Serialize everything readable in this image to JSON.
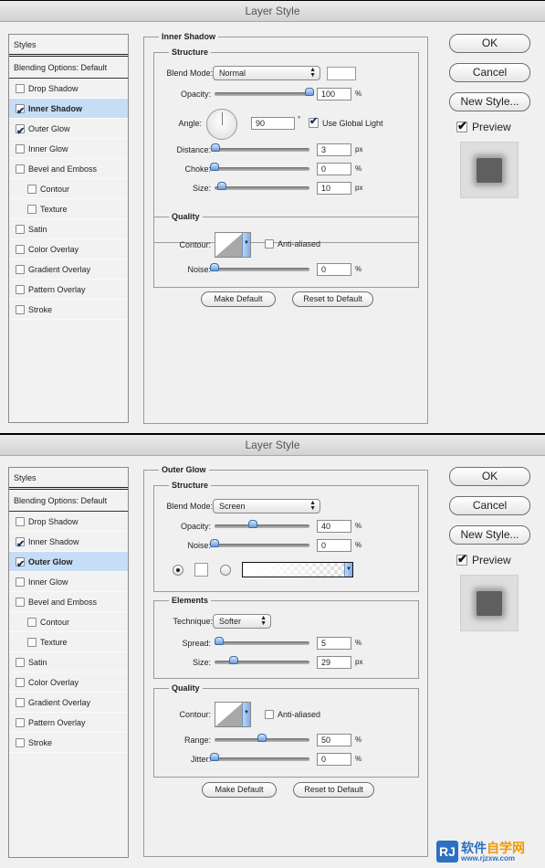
{
  "dialogs": [
    {
      "title": "Layer Style",
      "styles_header": "Styles",
      "blending_options": "Blending Options: Default",
      "items": [
        {
          "label": "Drop Shadow",
          "checked": false,
          "selected": false,
          "sub": false
        },
        {
          "label": "Inner Shadow",
          "checked": true,
          "selected": true,
          "sub": false
        },
        {
          "label": "Outer Glow",
          "checked": true,
          "selected": false,
          "sub": false
        },
        {
          "label": "Inner Glow",
          "checked": false,
          "selected": false,
          "sub": false
        },
        {
          "label": "Bevel and Emboss",
          "checked": false,
          "selected": false,
          "sub": false
        },
        {
          "label": "Contour",
          "checked": false,
          "selected": false,
          "sub": true
        },
        {
          "label": "Texture",
          "checked": false,
          "selected": false,
          "sub": true
        },
        {
          "label": "Satin",
          "checked": false,
          "selected": false,
          "sub": false
        },
        {
          "label": "Color Overlay",
          "checked": false,
          "selected": false,
          "sub": false
        },
        {
          "label": "Gradient Overlay",
          "checked": false,
          "selected": false,
          "sub": false
        },
        {
          "label": "Pattern Overlay",
          "checked": false,
          "selected": false,
          "sub": false
        },
        {
          "label": "Stroke",
          "checked": false,
          "selected": false,
          "sub": false
        }
      ],
      "panel_title": "Inner Shadow",
      "structure": {
        "title": "Structure",
        "blend_mode_label": "Blend Mode:",
        "blend_mode": "Normal",
        "blend_color": "#ffffff",
        "opacity": {
          "label": "Opacity:",
          "value": "100",
          "unit": "%",
          "fraction": 1.0
        },
        "angle": {
          "label": "Angle:",
          "value": "90",
          "unit": "°",
          "degrees": 90
        },
        "use_global_light": {
          "label": "Use Global Light",
          "checked": true
        },
        "distance": {
          "label": "Distance:",
          "value": "3",
          "unit": "px",
          "fraction": 0.01
        },
        "choke": {
          "label": "Choke:",
          "value": "0",
          "unit": "%",
          "fraction": 0.0
        },
        "size": {
          "label": "Size:",
          "value": "10",
          "unit": "px",
          "fraction": 0.08
        }
      },
      "quality": {
        "title": "Quality",
        "contour_label": "Contour:",
        "anti_aliased": {
          "label": "Anti-aliased",
          "checked": false
        },
        "noise": {
          "label": "Noise:",
          "value": "0",
          "unit": "%",
          "fraction": 0.0
        }
      },
      "make_default": "Make Default",
      "reset_default": "Reset to Default"
    },
    {
      "title": "Layer Style",
      "styles_header": "Styles",
      "blending_options": "Blending Options: Default",
      "items": [
        {
          "label": "Drop Shadow",
          "checked": false,
          "selected": false,
          "sub": false
        },
        {
          "label": "Inner Shadow",
          "checked": true,
          "selected": false,
          "sub": false
        },
        {
          "label": "Outer Glow",
          "checked": true,
          "selected": true,
          "sub": false
        },
        {
          "label": "Inner Glow",
          "checked": false,
          "selected": false,
          "sub": false
        },
        {
          "label": "Bevel and Emboss",
          "checked": false,
          "selected": false,
          "sub": false
        },
        {
          "label": "Contour",
          "checked": false,
          "selected": false,
          "sub": true
        },
        {
          "label": "Texture",
          "checked": false,
          "selected": false,
          "sub": true
        },
        {
          "label": "Satin",
          "checked": false,
          "selected": false,
          "sub": false
        },
        {
          "label": "Color Overlay",
          "checked": false,
          "selected": false,
          "sub": false
        },
        {
          "label": "Gradient Overlay",
          "checked": false,
          "selected": false,
          "sub": false
        },
        {
          "label": "Pattern Overlay",
          "checked": false,
          "selected": false,
          "sub": false
        },
        {
          "label": "Stroke",
          "checked": false,
          "selected": false,
          "sub": false
        }
      ],
      "panel_title": "Outer Glow",
      "structure": {
        "title": "Structure",
        "blend_mode_label": "Blend Mode:",
        "blend_mode": "Screen",
        "opacity": {
          "label": "Opacity:",
          "value": "40",
          "unit": "%",
          "fraction": 0.4
        },
        "noise": {
          "label": "Noise:",
          "value": "0",
          "unit": "%",
          "fraction": 0.0
        },
        "color_mode": "solid"
      },
      "elements": {
        "title": "Elements",
        "technique_label": "Technique:",
        "technique": "Softer",
        "spread": {
          "label": "Spread:",
          "value": "5",
          "unit": "%",
          "fraction": 0.05
        },
        "size": {
          "label": "Size:",
          "value": "29",
          "unit": "px",
          "fraction": 0.2
        }
      },
      "quality": {
        "title": "Quality",
        "contour_label": "Contour:",
        "anti_aliased": {
          "label": "Anti-aliased",
          "checked": false
        },
        "range": {
          "label": "Range:",
          "value": "50",
          "unit": "%",
          "fraction": 0.5
        },
        "jitter": {
          "label": "Jitter:",
          "value": "0",
          "unit": "%",
          "fraction": 0.0
        }
      },
      "make_default": "Make Default",
      "reset_default": "Reset to Default"
    }
  ],
  "buttons": {
    "ok": "OK",
    "cancel": "Cancel",
    "new_style": "New Style...",
    "preview": "Preview",
    "preview_checked": true
  },
  "watermark": {
    "logo": "RJ",
    "name_part1": "软件",
    "name_part2": "自学网",
    "url": "www.rjzxw.com"
  }
}
